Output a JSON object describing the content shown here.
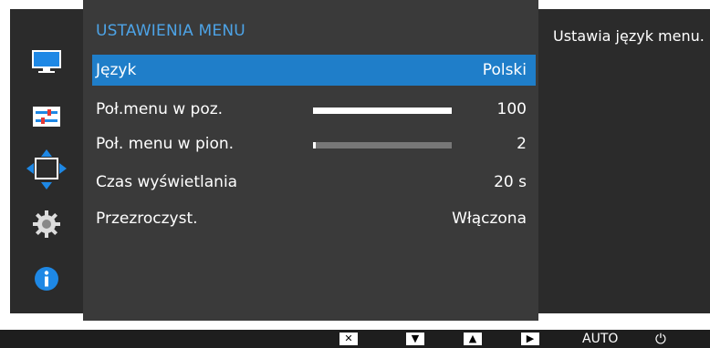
{
  "menu": {
    "title": "USTAWIENIA MENU",
    "rows": [
      {
        "label": "Język",
        "value": "Polski",
        "selected": true
      },
      {
        "label": "Poł.menu w poz.",
        "value": "100",
        "bar": 100
      },
      {
        "label": "Poł. menu w pion.",
        "value": "2",
        "bar": 2
      },
      {
        "label": "Czas wyświetlania",
        "value": "20 s"
      },
      {
        "label": "Przezroczyst.",
        "value": "Włączona"
      }
    ]
  },
  "sidebar": {
    "icons": [
      "monitor-icon",
      "settings-sliders-icon",
      "position-arrows-icon",
      "gear-icon",
      "info-icon"
    ],
    "active": "position-arrows-icon"
  },
  "help": {
    "text": "Ustawia język menu."
  },
  "bottom_bar": {
    "buttons": [
      "close-icon",
      "down-arrow-icon",
      "up-arrow-icon",
      "right-arrow-icon",
      "auto-button",
      "power-icon"
    ],
    "auto_label": "AUTO"
  },
  "colors": {
    "accent": "#1f7ec9",
    "title": "#4da3e6",
    "panel": "#3a3a3a",
    "background": "#2b2b2b"
  }
}
